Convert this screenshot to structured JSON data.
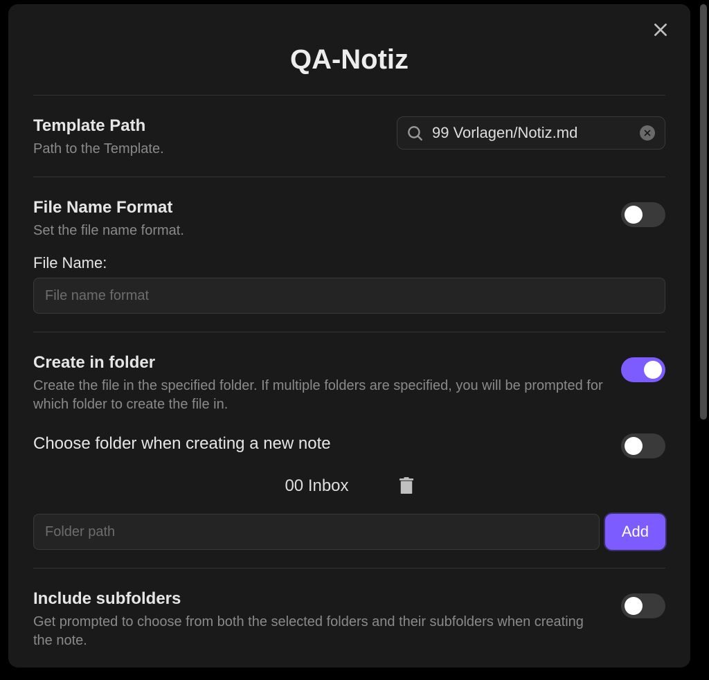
{
  "modal": {
    "title": "QA-Notiz"
  },
  "templatePath": {
    "title": "Template Path",
    "desc": "Path to the Template.",
    "value": "99 Vorlagen/Notiz.md"
  },
  "fileNameFormat": {
    "title": "File Name Format",
    "desc": "Set the file name format.",
    "toggle": false,
    "label": "File Name:",
    "placeholder": "File name format",
    "value": ""
  },
  "createInFolder": {
    "title": "Create in folder",
    "desc": "Create the file in the specified folder. If multiple folders are specified, you will be prompted for which folder to create the file in.",
    "toggle": true,
    "chooseFolderTitle": "Choose folder when creating a new note",
    "chooseFolderToggle": false,
    "folders": [
      "00 Inbox"
    ],
    "folderInputPlaceholder": "Folder path",
    "folderInputValue": "",
    "addLabel": "Add"
  },
  "includeSubfolders": {
    "title": "Include subfolders",
    "desc": "Get prompted to choose from both the selected folders and their subfolders when creating the note.",
    "toggle": false
  }
}
